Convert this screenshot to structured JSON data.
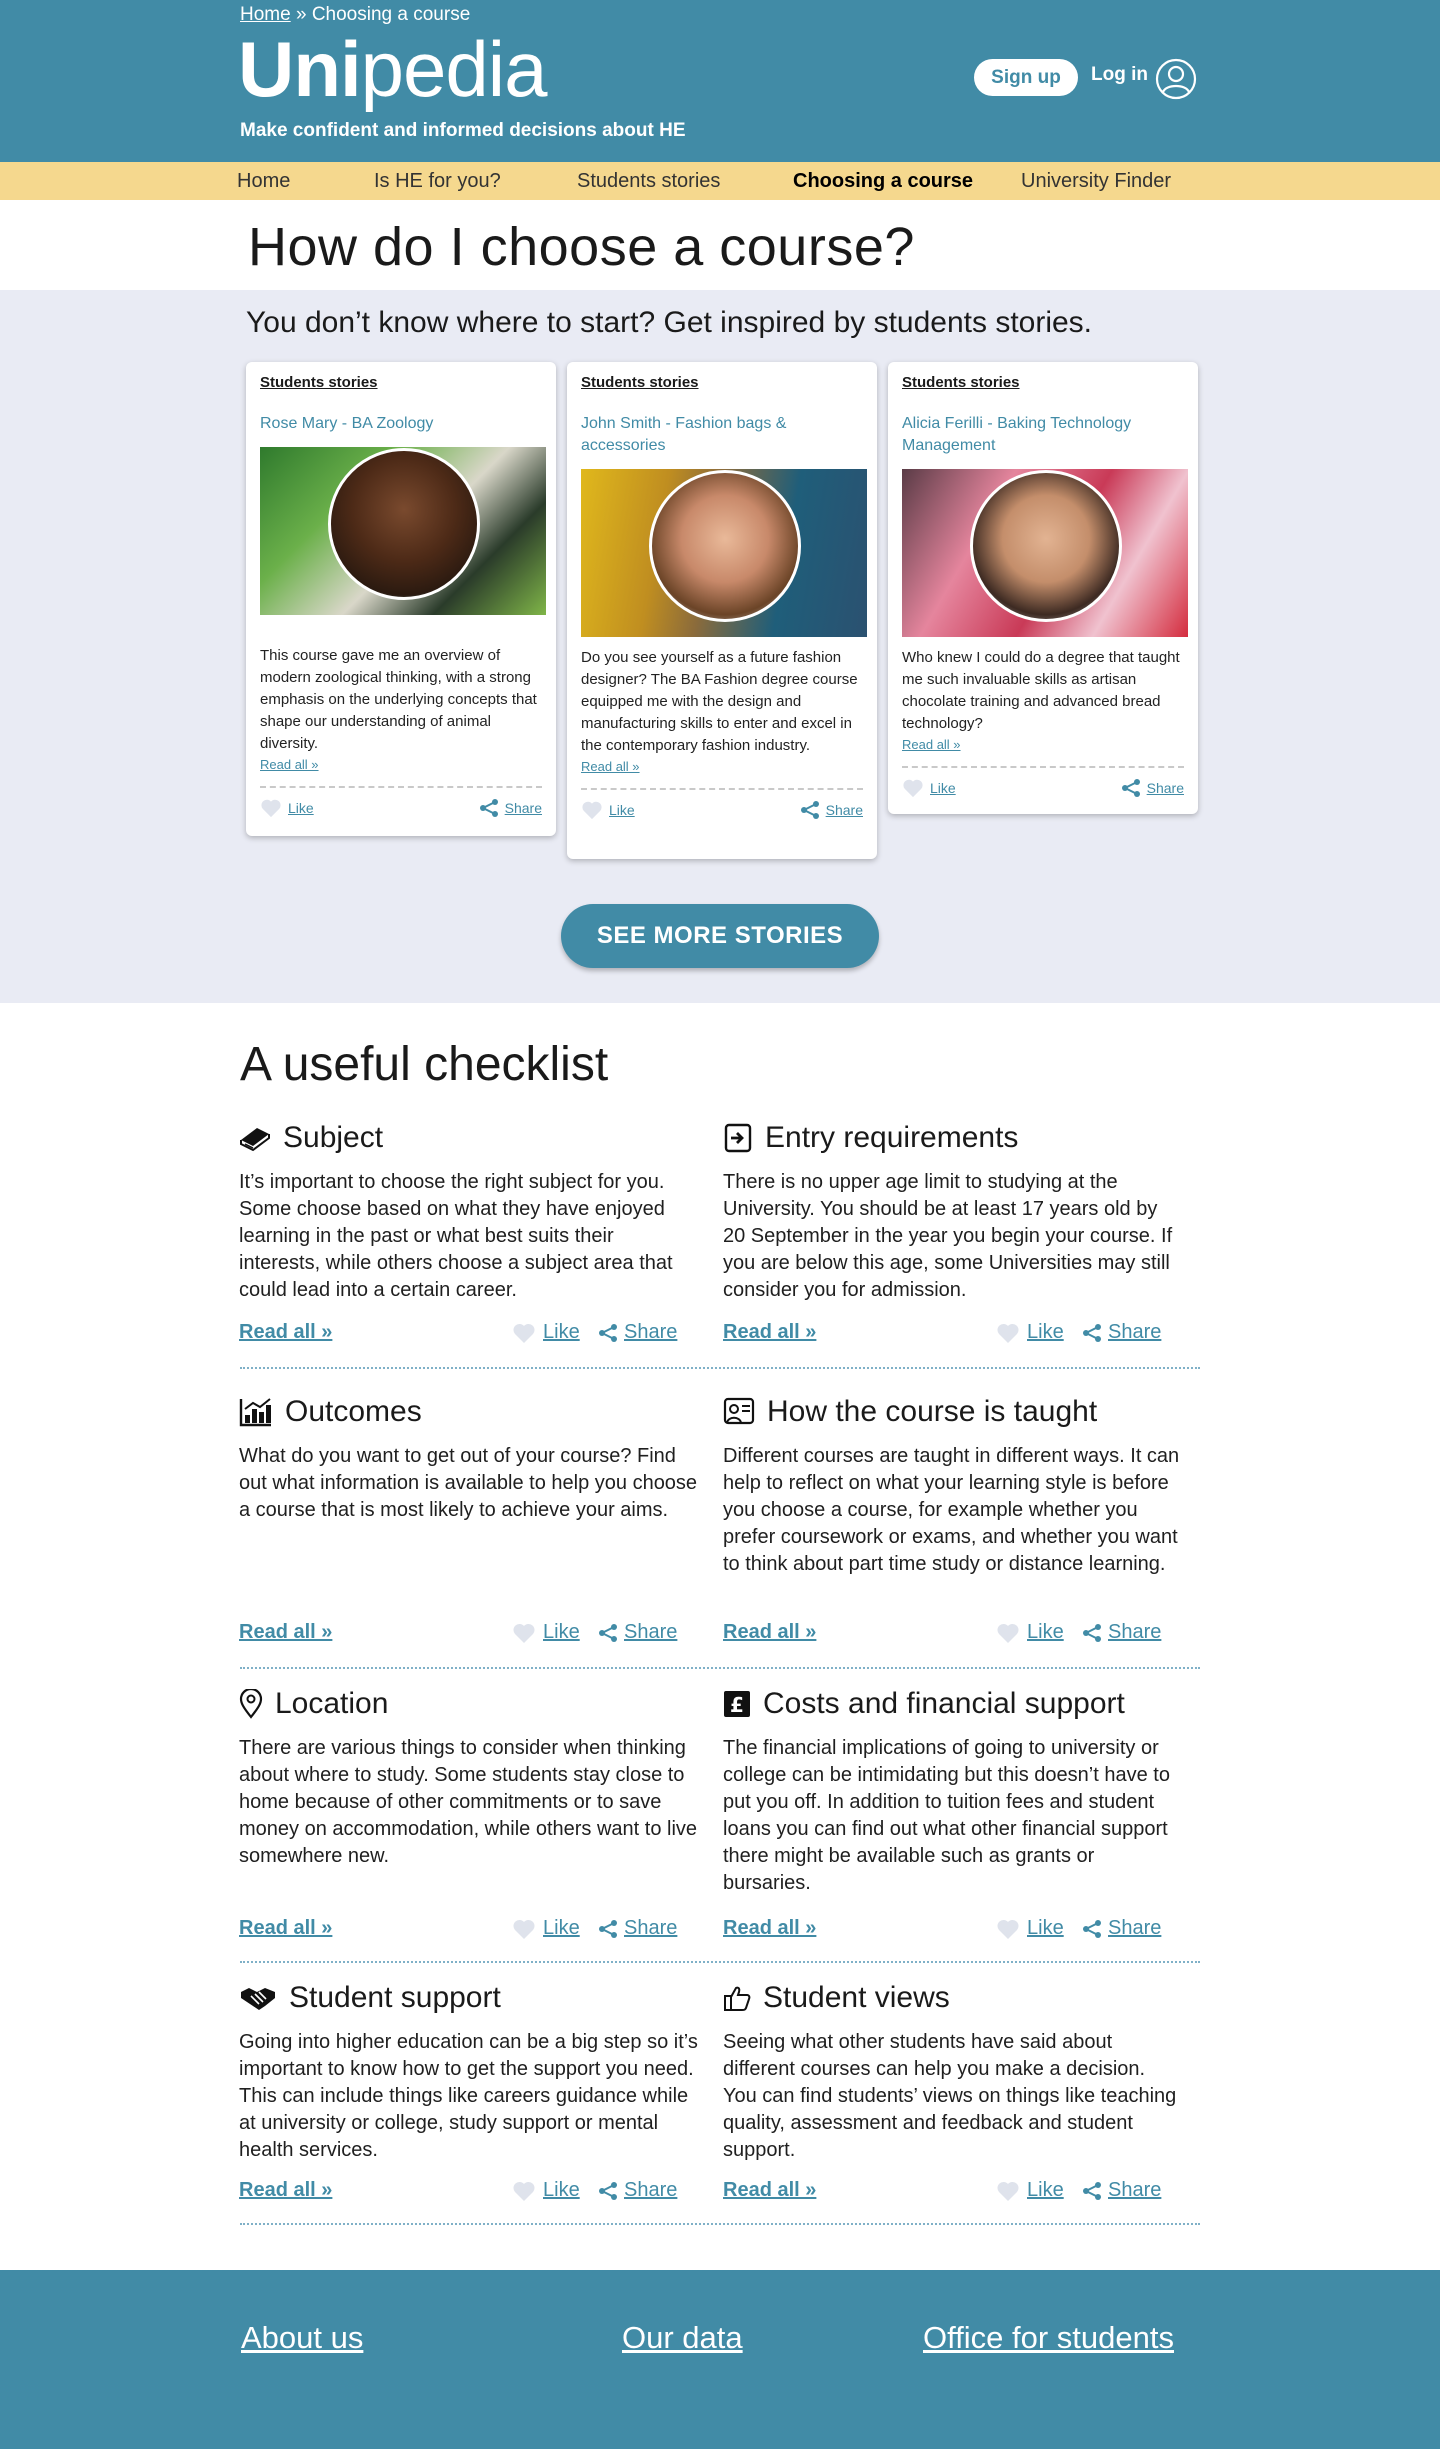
{
  "header": {
    "breadcrumb_home": "Home",
    "breadcrumb_sep": "»",
    "breadcrumb_current": "Choosing a course",
    "logo_bold": "Uni",
    "logo_light": "pedia",
    "tagline": "Make confident and informed decisions about HE",
    "signup": "Sign up",
    "login": "Log in"
  },
  "nav": {
    "items": [
      "Home",
      "Is HE for you?",
      "Students stories",
      "Choosing a course",
      "University Finder"
    ],
    "active": "Choosing a course"
  },
  "page_title": "How do I choose a course?",
  "stories": {
    "heading": "You don’t know where to start? Get inspired by students stories.",
    "cards": [
      {
        "tag": "Students stories",
        "name": "Rose Mary - BA Zoology",
        "text": "This course gave me an overview of modern zoological thinking, with a strong emphasis on the underlying concepts that shape our understanding of animal diversity.",
        "read": "Read all »",
        "like": "Like",
        "share": "Share"
      },
      {
        "tag": "Students stories",
        "name": "John Smith - Fashion bags & accessories",
        "text": "Do you see yourself as a future fashion designer? The BA Fashion degree course equipped me with the design and manufacturing skills to enter and excel in the contemporary fashion industry.",
        "read": "Read all »",
        "like": "Like",
        "share": "Share"
      },
      {
        "tag": "Students stories",
        "name": "Alicia Ferilli - Baking Technology Management",
        "text": "Who knew I could do a degree that taught me such invaluable skills as artisan chocolate training and advanced bread technology?",
        "read": "Read all »",
        "like": "Like",
        "share": "Share"
      }
    ],
    "see_more": "SEE MORE STORIES"
  },
  "checklist": {
    "title": "A useful checklist",
    "read": "Read all »",
    "like": "Like",
    "share": "Share",
    "items": [
      {
        "icon": "book-icon",
        "title": "Subject",
        "text": "It’s important to choose the right subject for you. Some choose based on what they have enjoyed learning in the past or what best suits their interests, while others choose a subject area that could lead into a certain career."
      },
      {
        "icon": "entry-icon",
        "title": "Entry requirements",
        "text": "There is no upper age limit to studying at the University. You should be at least 17 years old by 20 September in the year you begin your course. If you are below this age, some Universities may still consider you for admission."
      },
      {
        "icon": "chart-icon",
        "title": "Outcomes",
        "text": "What do you want to get out of your course? Find out what information is available to help you choose a course that is most likely to achieve your aims."
      },
      {
        "icon": "teacher-icon",
        "title": "How the course is taught",
        "text": "Different courses are taught in different ways. It can help to reflect on what your learning style is before you choose a course, for example whether you prefer coursework or exams, and whether you want to think about part time study or distance learning."
      },
      {
        "icon": "location-pin-icon",
        "title": "Location",
        "text": "There are various things to consider when thinking about where to study. Some students stay close to home because of other commitments or to save money on accommodation, while others want to live somewhere new."
      },
      {
        "icon": "pound-icon",
        "title": "Costs and financial support",
        "text": "The financial implications of going to university or college can be intimidating but this doesn’t have to put you off. In addition to tuition fees and student loans you can find out what other financial support there might be available such as grants or bursaries."
      },
      {
        "icon": "handshake-icon",
        "title": "Student support",
        "text": "Going into higher education can be a big step so it’s important to know how to get the support you need. This can include things like careers guidance while at university or college, study support or mental health services."
      },
      {
        "icon": "thumbs-up-icon",
        "title": "Student views",
        "text": "Seeing what other students have said about different courses can help you make a decision. You can find students’ views on things like teaching quality, assessment and feedback and student support."
      }
    ]
  },
  "footer": {
    "links": [
      "About us",
      "Our data",
      "Office for students"
    ]
  },
  "colors": {
    "brand": "#418ba6",
    "nav": "#f5d88e",
    "stories_bg": "#e9ebf4"
  }
}
